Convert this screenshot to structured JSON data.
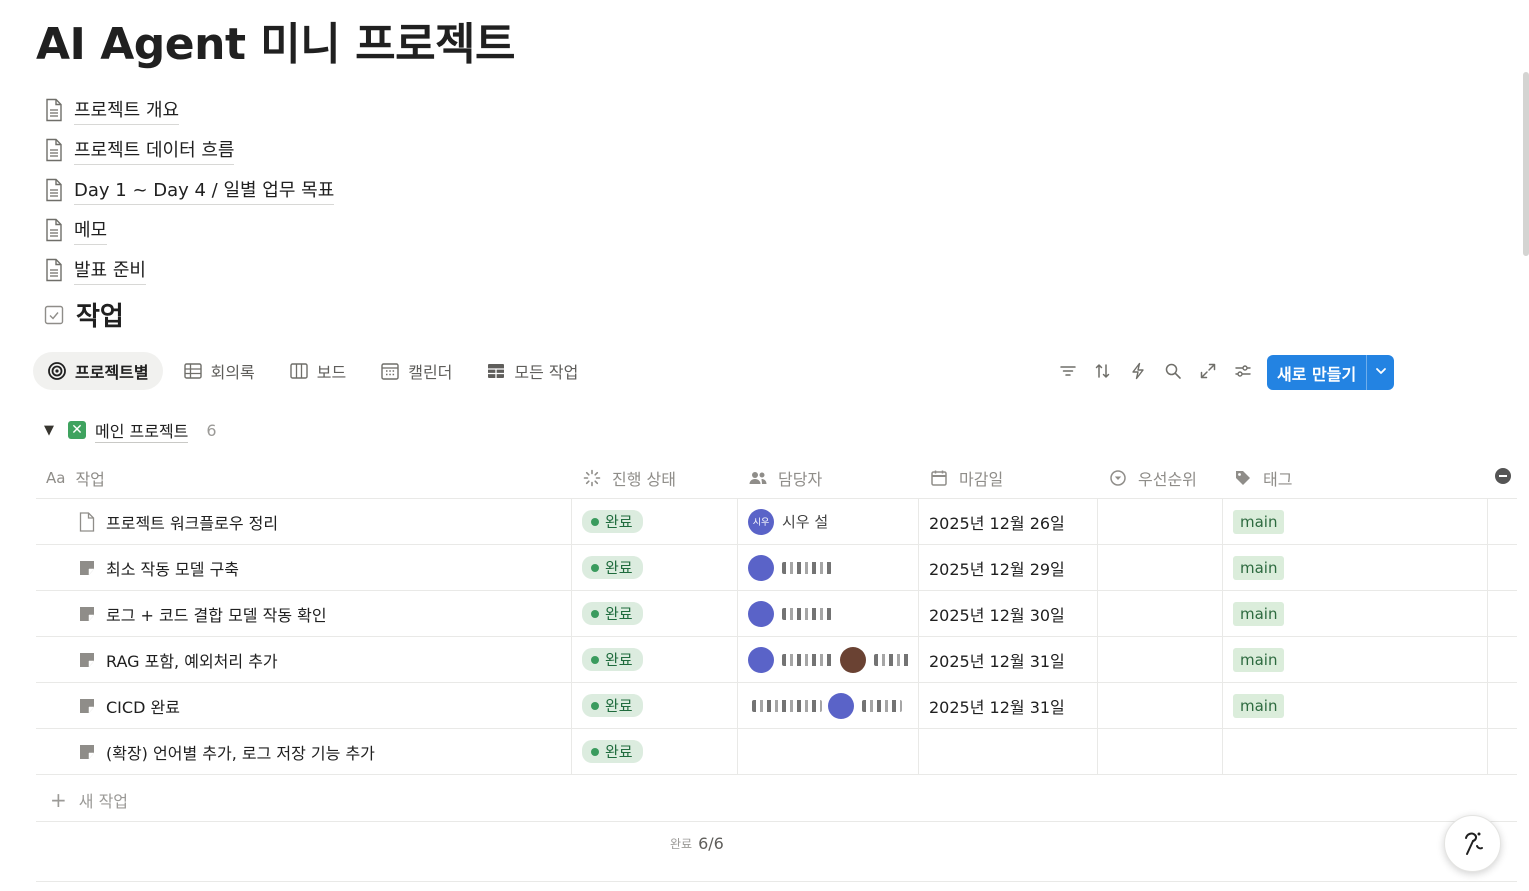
{
  "page": {
    "title": "AI Agent 미니 프로젝트"
  },
  "subpages": [
    {
      "label": "프로젝트 개요",
      "icon": "document-icon"
    },
    {
      "label": "프로젝트 데이터 흐름",
      "icon": "document-icon"
    },
    {
      "label": "Day 1 ~ Day 4 / 일별 업무 목표",
      "icon": "document-icon"
    },
    {
      "label": "메모",
      "icon": "document-icon"
    },
    {
      "label": "발표 준비",
      "icon": "document-icon"
    }
  ],
  "database": {
    "title": "작업",
    "icon": "checkbox-icon"
  },
  "views": [
    {
      "label": "프로젝트별",
      "icon": "target-icon",
      "active": true
    },
    {
      "label": "회의록",
      "icon": "table-icon",
      "active": false
    },
    {
      "label": "보드",
      "icon": "board-icon",
      "active": false
    },
    {
      "label": "캘린더",
      "icon": "calendar-icon",
      "active": false
    },
    {
      "label": "모든 작업",
      "icon": "grid-icon",
      "active": false
    }
  ],
  "toolbar": {
    "tools": [
      "filter-icon",
      "sort-icon",
      "lightning-icon",
      "search-icon",
      "expand-icon",
      "settings-icon"
    ],
    "new_button": "새로 만들기",
    "accent": "#2383e2"
  },
  "group": {
    "name": "메인 프로젝트",
    "count": "6"
  },
  "columns": {
    "task": "작업",
    "status": "진행 상태",
    "assignee": "담당자",
    "due": "마감일",
    "priority": "우선순위",
    "tag": "태그"
  },
  "rows": [
    {
      "task": "프로젝트 워크플로우 정리",
      "icon": "document-icon",
      "status": "완료",
      "assignees": [
        {
          "avatar": "시우",
          "name": "시우 설"
        }
      ],
      "due": "2025년 12월 26일",
      "priority": "",
      "tag": "main"
    },
    {
      "task": "최소 작동 모델 구축",
      "icon": "note-icon",
      "status": "완료",
      "assignees": [
        {
          "avatar": "",
          "name": ""
        }
      ],
      "due": "2025년 12월 29일",
      "priority": "",
      "tag": "main"
    },
    {
      "task": "로그 + 코드 결합 모델 작동 확인",
      "icon": "note-icon",
      "status": "완료",
      "assignees": [
        {
          "avatar": "",
          "name": ""
        }
      ],
      "due": "2025년 12월 30일",
      "priority": "",
      "tag": "main"
    },
    {
      "task": "RAG 포함, 예외처리 추가",
      "icon": "note-icon",
      "status": "완료",
      "assignees": [
        {
          "avatar": "",
          "name": ""
        },
        {
          "avatar": "",
          "name": ""
        }
      ],
      "due": "2025년 12월 31일",
      "priority": "",
      "tag": "main"
    },
    {
      "task": "CICD 완료",
      "icon": "note-icon",
      "status": "완료",
      "assignees": [
        {
          "avatar": "",
          "name": ""
        },
        {
          "avatar": "",
          "name": ""
        }
      ],
      "due": "2025년 12월 31일",
      "priority": "",
      "tag": "main"
    },
    {
      "task": "(확장) 언어별 추가, 로그 저장 기능 추가",
      "icon": "note-icon",
      "status": "완료",
      "assignees": [],
      "due": "",
      "priority": "",
      "tag": ""
    }
  ],
  "new_row": {
    "label": "새 작업"
  },
  "summary": {
    "label": "완료",
    "value": "6/6"
  },
  "colors": {
    "status_bg": "#dcecdf",
    "tag_bg": "#dbeddb",
    "group_icon": "#3fa35f"
  }
}
